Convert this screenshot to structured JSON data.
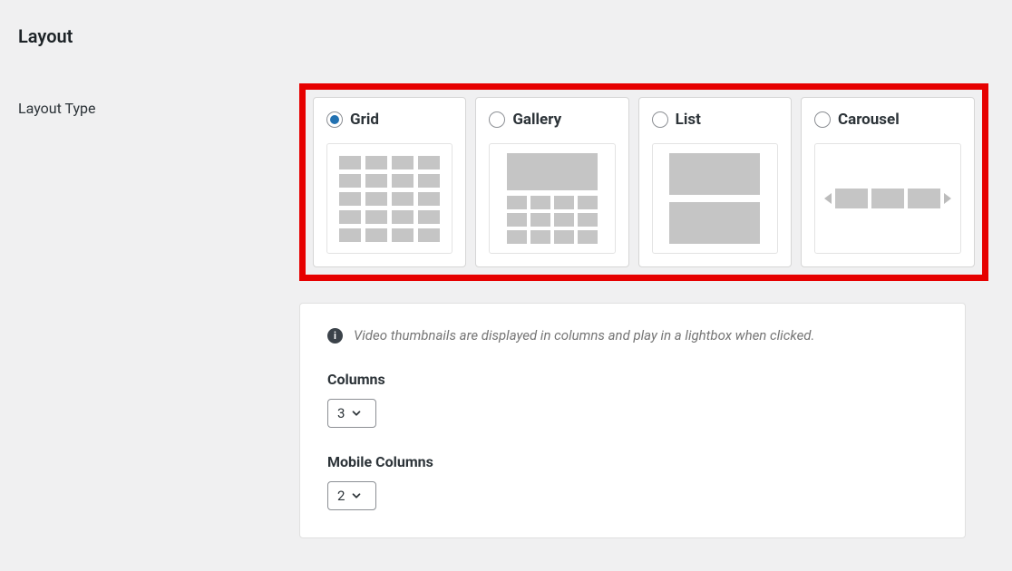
{
  "section_title": "Layout",
  "layout_type_label": "Layout Type",
  "layouts": {
    "grid": "Grid",
    "gallery": "Gallery",
    "list": "List",
    "carousel": "Carousel"
  },
  "selected_layout": "grid",
  "description": "Video thumbnails are displayed in columns and play in a lightbox when clicked.",
  "columns": {
    "label": "Columns",
    "value": "3"
  },
  "mobile_columns": {
    "label": "Mobile Columns",
    "value": "2"
  },
  "info_glyph": "i"
}
